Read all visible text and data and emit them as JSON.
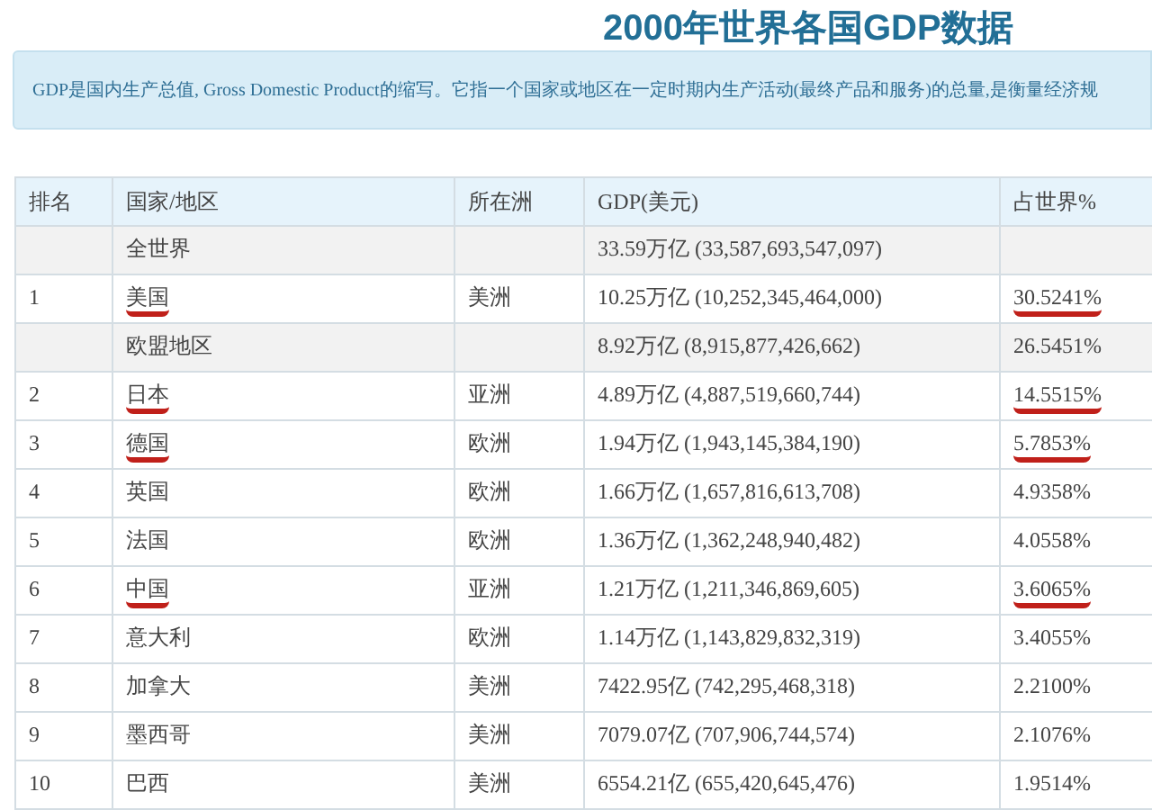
{
  "title": "2000年世界各国GDP数据",
  "notice": "GDP是国内生产总值, Gross Domestic Product的缩写。它指一个国家或地区在一定时期内生产活动(最终产品和服务)的总量,是衡量经济规",
  "table": {
    "columns": [
      "排名",
      "国家/地区",
      "所在洲",
      "GDP(美元)",
      "占世界%"
    ],
    "rows": [
      {
        "kind": "summary",
        "rank": "",
        "country": "全世界",
        "continent": "",
        "gdp": "33.59万亿 (33,587,693,547,097)",
        "share": "",
        "country_marked": false
      },
      {
        "kind": "country",
        "rank": "1",
        "country": "美国",
        "continent": "美洲",
        "gdp": "10.25万亿 (10,252,345,464,000)",
        "share": "30.5241%",
        "country_marked": true,
        "share_marked": true
      },
      {
        "kind": "summary",
        "rank": "",
        "country": "欧盟地区",
        "continent": "",
        "gdp": "8.92万亿 (8,915,877,426,662)",
        "share": "26.5451%",
        "country_marked": false,
        "share_marked": false
      },
      {
        "kind": "country",
        "rank": "2",
        "country": "日本",
        "continent": "亚洲",
        "gdp": "4.89万亿 (4,887,519,660,744)",
        "share": "14.5515%",
        "country_marked": true,
        "share_marked": true
      },
      {
        "kind": "country",
        "rank": "3",
        "country": "德国",
        "continent": "欧洲",
        "gdp": "1.94万亿 (1,943,145,384,190)",
        "share": "5.7853%",
        "country_marked": true,
        "share_marked": true
      },
      {
        "kind": "country",
        "rank": "4",
        "country": "英国",
        "continent": "欧洲",
        "gdp": "1.66万亿 (1,657,816,613,708)",
        "share": "4.9358%",
        "country_marked": false,
        "share_marked": false
      },
      {
        "kind": "country",
        "rank": "5",
        "country": "法国",
        "continent": "欧洲",
        "gdp": "1.36万亿 (1,362,248,940,482)",
        "share": "4.0558%",
        "country_marked": false,
        "share_marked": false
      },
      {
        "kind": "country",
        "rank": "6",
        "country": "中国",
        "continent": "亚洲",
        "gdp": "1.21万亿 (1,211,346,869,605)",
        "share": "3.6065%",
        "country_marked": true,
        "share_marked": true
      },
      {
        "kind": "country",
        "rank": "7",
        "country": "意大利",
        "continent": "欧洲",
        "gdp": "1.14万亿 (1,143,829,832,319)",
        "share": "3.4055%",
        "country_marked": false,
        "share_marked": false
      },
      {
        "kind": "country",
        "rank": "8",
        "country": "加拿大",
        "continent": "美洲",
        "gdp": "7422.95亿 (742,295,468,318)",
        "share": "2.2100%",
        "country_marked": false,
        "share_marked": false
      },
      {
        "kind": "country",
        "rank": "9",
        "country": "墨西哥",
        "continent": "美洲",
        "gdp": "7079.07亿 (707,906,744,574)",
        "share": "2.1076%",
        "country_marked": false,
        "share_marked": false
      },
      {
        "kind": "country",
        "rank": "10",
        "country": "巴西",
        "continent": "美洲",
        "gdp": "6554.21亿 (655,420,645,476)",
        "share": "1.9514%",
        "country_marked": false,
        "share_marked": false
      }
    ]
  }
}
